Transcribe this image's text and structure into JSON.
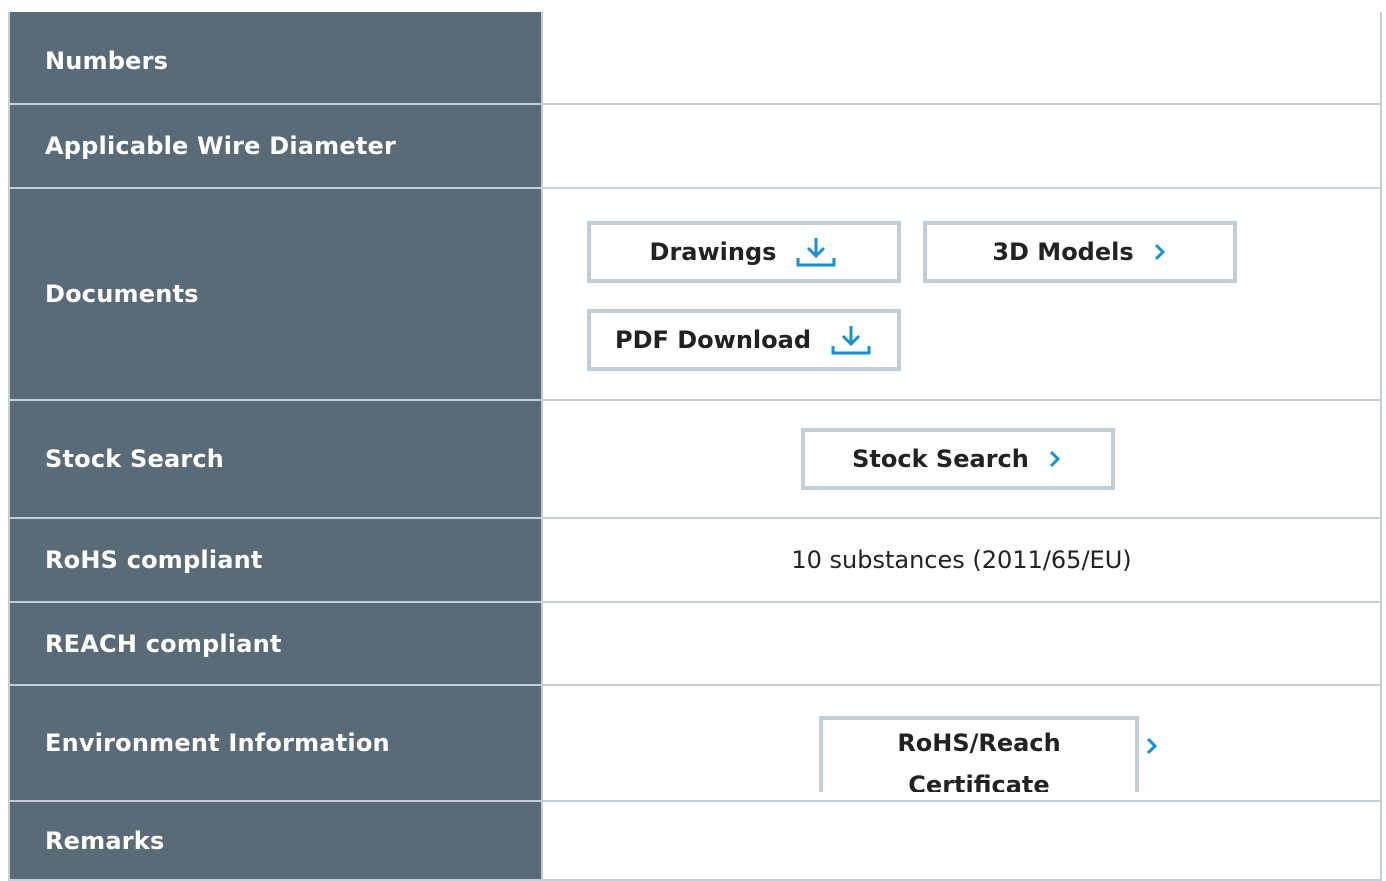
{
  "rows": {
    "part_numbers": {
      "label": "Numbers"
    },
    "wire_diameter": {
      "label": "Applicable Wire Diameter"
    },
    "documents": {
      "label": "Documents",
      "drawings": "Drawings",
      "models": "3D Models",
      "pdf": "PDF Download"
    },
    "stock": {
      "label": "Stock Search",
      "button": "Stock Search"
    },
    "rohs": {
      "label": "RoHS compliant",
      "value": "10 substances (2011/65/EU)"
    },
    "reach": {
      "label": "REACH compliant"
    },
    "environment": {
      "label": "Environment Information",
      "cert_line1": "RoHS/Reach",
      "cert_line2": "Certificate"
    },
    "remarks": {
      "label": "Remarks"
    }
  },
  "icons": {
    "download": "download-icon",
    "chevron": "chevron-right-icon"
  },
  "colors": {
    "label_bg": "#5a6b77",
    "border": "#c5ced6",
    "accent": "#1a8fd1"
  }
}
